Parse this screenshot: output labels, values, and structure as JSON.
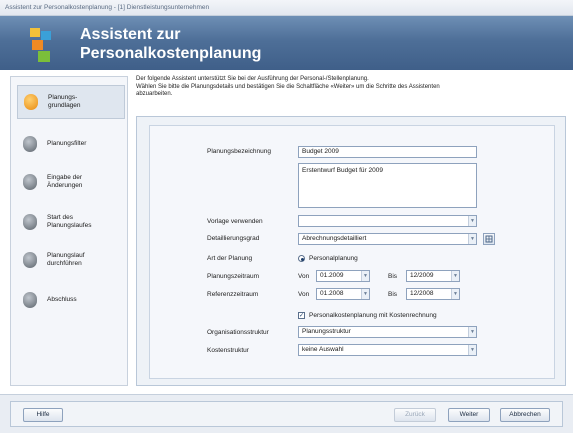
{
  "window": {
    "title": "Assistent zur Personalkostenplanung - [1] Dienstleistungsunternehmen"
  },
  "header": {
    "title_line1": "Assistent zur",
    "title_line2": "Personalkostenplanung"
  },
  "sidebar": {
    "items": [
      {
        "label": "Planungs-grundlagen",
        "active": true
      },
      {
        "label": "Planungsfilter",
        "active": false
      },
      {
        "label": "Eingabe der Änderungen",
        "active": false
      },
      {
        "label": "Start des Planungslaufes",
        "active": false
      },
      {
        "label": "Planungslauf durchführen",
        "active": false
      },
      {
        "label": "Abschluss",
        "active": false
      }
    ]
  },
  "intro": {
    "line1": "Der folgende Assistent unterstützt Sie bei der Ausführung der Personal-/Stellenplanung.",
    "line2": "Wählen Sie bitte die Planungsdetails und bestätigen Sie die Schaltfläche «Weiter» um die Schritte des Assistenten",
    "line3": "abzuarbeiten."
  },
  "form": {
    "bezeichnung_label": "Planungsbezeichnung",
    "bezeichnung_value": "Budget 2009",
    "beschreibung_value": "Erstentwurf Budget für 2009",
    "vorlage_label": "Vorlage verwenden",
    "vorlage_value": "",
    "detail_label": "Detaillierungsgrad",
    "detail_value": "Abrechnungsdetailliert",
    "art_label": "Art der Planung",
    "art_value": "Personalplanung",
    "pz_label": "Planungszeitraum",
    "pz_von_label": "Von",
    "pz_von": "01.2009",
    "pz_bis_label": "Bis",
    "pz_bis": "12/2009",
    "rz_label": "Referenzzeitraum",
    "rz_von_label": "Von",
    "rz_von": "01.2008",
    "rz_bis_label": "Bis",
    "rz_bis": "12/2008",
    "kosten_check_label": "Personalkostenplanung mit Kostenrechnung",
    "org_label": "Organisationsstruktur",
    "org_value": "Planungsstruktur",
    "kst_label": "Kostenstruktur",
    "kst_value": "keine Auswahl"
  },
  "footer": {
    "help_label": "Hilfe",
    "back_label": "Zurück",
    "next_label": "Weiter",
    "cancel_label": "Abbrechen"
  },
  "colors": {
    "header": "#4e6f98",
    "active_step_icon": "#f0a020",
    "step_icon": "#6f7780"
  }
}
